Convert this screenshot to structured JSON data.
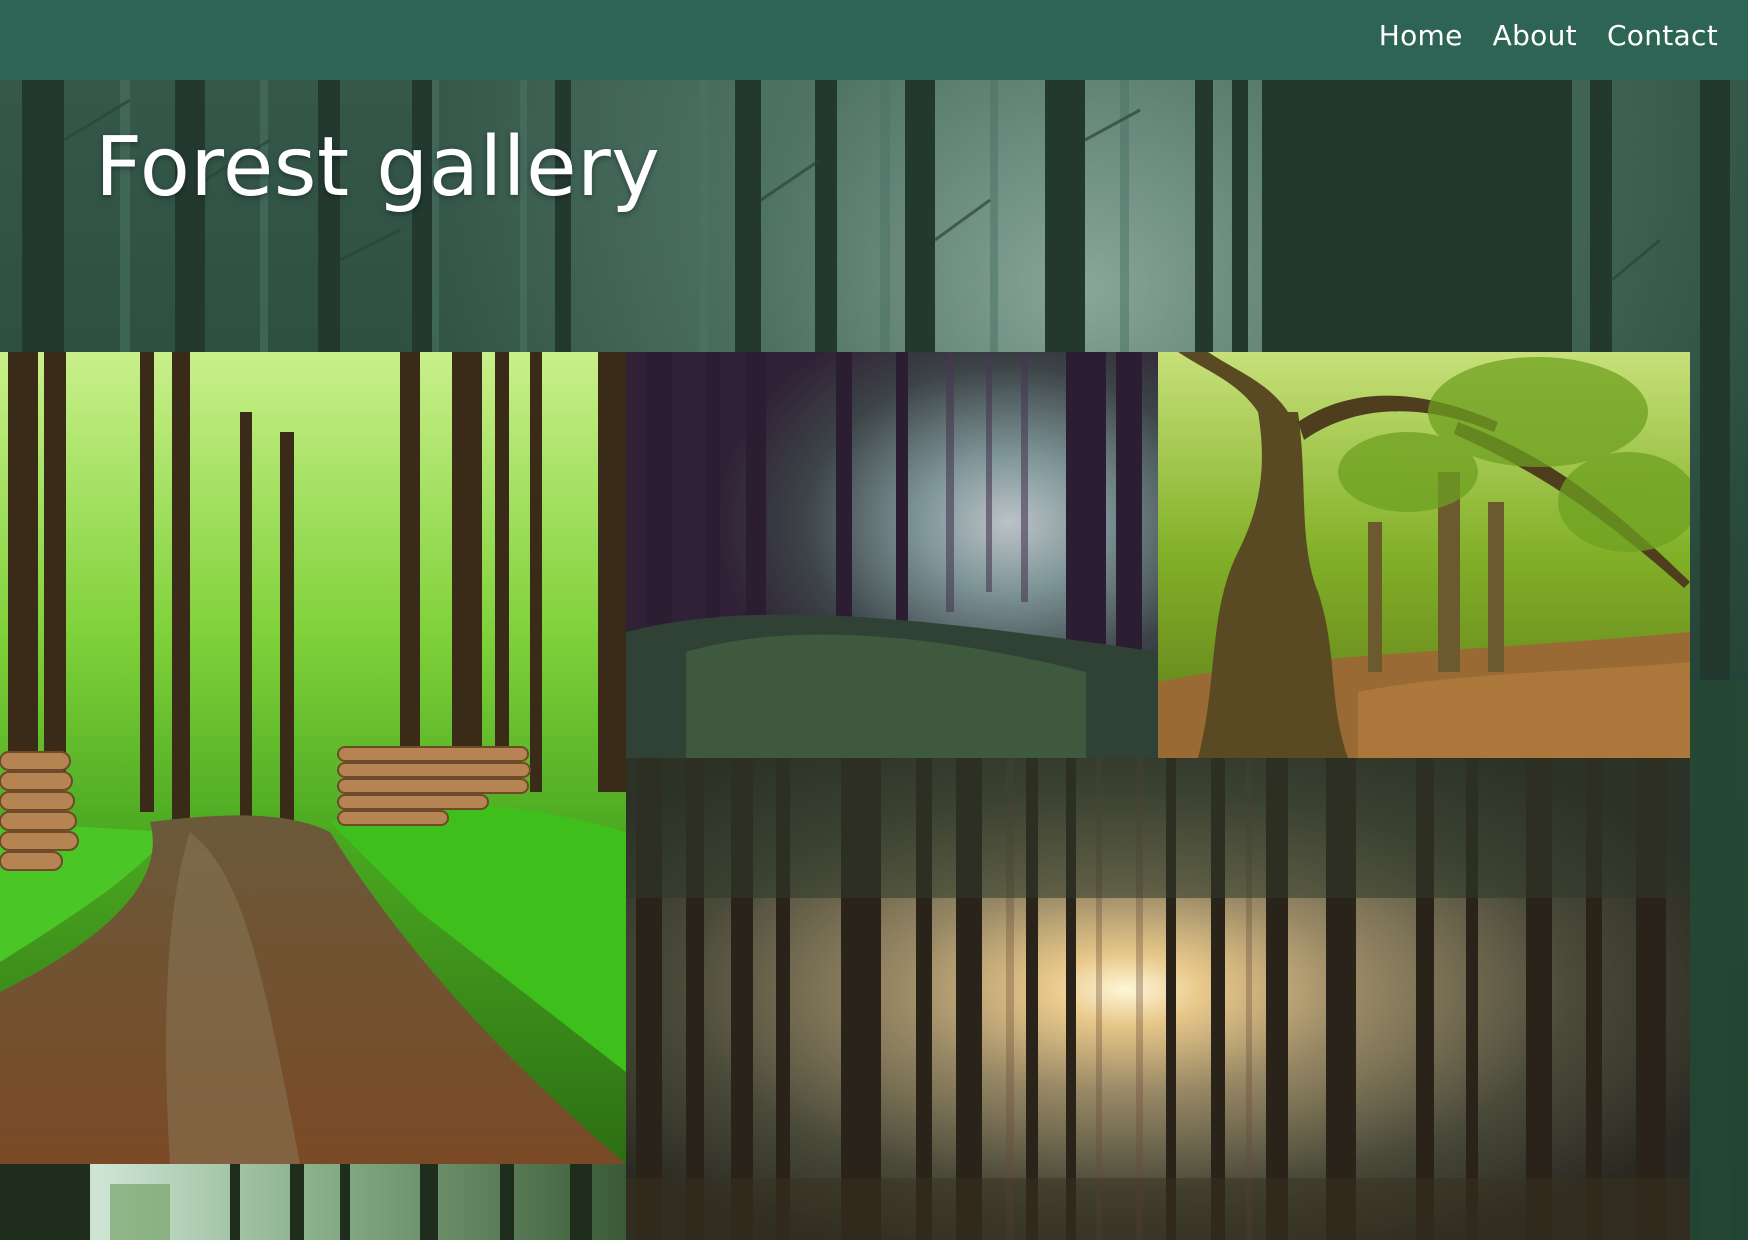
{
  "nav": {
    "links": [
      {
        "label": "Home"
      },
      {
        "label": "About"
      },
      {
        "label": "Contact"
      }
    ]
  },
  "hero": {
    "title": "Forest gallery"
  },
  "gallery": {
    "tiles": [
      {
        "id": "forest-path-photo"
      },
      {
        "id": "misty-forest-photo"
      },
      {
        "id": "old-oak-photo"
      },
      {
        "id": "sunlit-forest-photo"
      },
      {
        "id": "forest-photo-partial"
      }
    ]
  },
  "colors": {
    "navbar": "#2d6454",
    "nav_text": "#ffffff",
    "title_text": "#ffffff"
  }
}
